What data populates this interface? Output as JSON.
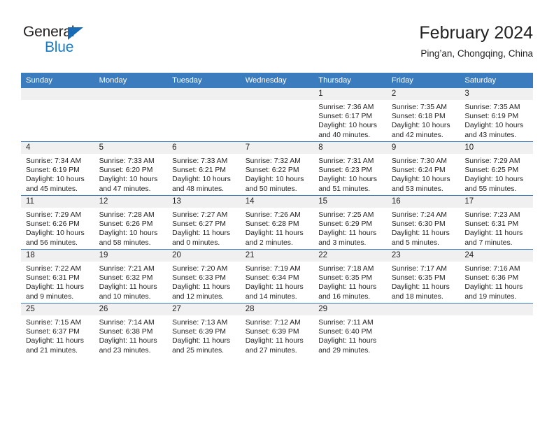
{
  "brand": {
    "name_part1": "General",
    "name_part2": "Blue",
    "accent_color": "#1a7bc6",
    "header_color": "#3a7cbe"
  },
  "header": {
    "title": "February 2024",
    "subtitle": "Ping’an, Chongqing, China"
  },
  "weekdays": [
    "Sunday",
    "Monday",
    "Tuesday",
    "Wednesday",
    "Thursday",
    "Friday",
    "Saturday"
  ],
  "labels": {
    "sunrise_prefix": "Sunrise:",
    "sunset_prefix": "Sunset:",
    "daylight_prefix": "Daylight:"
  },
  "weeks": [
    [
      {
        "day": "",
        "blank": true
      },
      {
        "day": "",
        "blank": true
      },
      {
        "day": "",
        "blank": true
      },
      {
        "day": "",
        "blank": true
      },
      {
        "day": "1",
        "sunrise": "Sunrise: 7:36 AM",
        "sunset": "Sunset: 6:17 PM",
        "daylight_l1": "Daylight: 10 hours",
        "daylight_l2": "and 40 minutes."
      },
      {
        "day": "2",
        "sunrise": "Sunrise: 7:35 AM",
        "sunset": "Sunset: 6:18 PM",
        "daylight_l1": "Daylight: 10 hours",
        "daylight_l2": "and 42 minutes."
      },
      {
        "day": "3",
        "sunrise": "Sunrise: 7:35 AM",
        "sunset": "Sunset: 6:19 PM",
        "daylight_l1": "Daylight: 10 hours",
        "daylight_l2": "and 43 minutes."
      }
    ],
    [
      {
        "day": "4",
        "sunrise": "Sunrise: 7:34 AM",
        "sunset": "Sunset: 6:19 PM",
        "daylight_l1": "Daylight: 10 hours",
        "daylight_l2": "and 45 minutes."
      },
      {
        "day": "5",
        "sunrise": "Sunrise: 7:33 AM",
        "sunset": "Sunset: 6:20 PM",
        "daylight_l1": "Daylight: 10 hours",
        "daylight_l2": "and 47 minutes."
      },
      {
        "day": "6",
        "sunrise": "Sunrise: 7:33 AM",
        "sunset": "Sunset: 6:21 PM",
        "daylight_l1": "Daylight: 10 hours",
        "daylight_l2": "and 48 minutes."
      },
      {
        "day": "7",
        "sunrise": "Sunrise: 7:32 AM",
        "sunset": "Sunset: 6:22 PM",
        "daylight_l1": "Daylight: 10 hours",
        "daylight_l2": "and 50 minutes."
      },
      {
        "day": "8",
        "sunrise": "Sunrise: 7:31 AM",
        "sunset": "Sunset: 6:23 PM",
        "daylight_l1": "Daylight: 10 hours",
        "daylight_l2": "and 51 minutes."
      },
      {
        "day": "9",
        "sunrise": "Sunrise: 7:30 AM",
        "sunset": "Sunset: 6:24 PM",
        "daylight_l1": "Daylight: 10 hours",
        "daylight_l2": "and 53 minutes."
      },
      {
        "day": "10",
        "sunrise": "Sunrise: 7:29 AM",
        "sunset": "Sunset: 6:25 PM",
        "daylight_l1": "Daylight: 10 hours",
        "daylight_l2": "and 55 minutes."
      }
    ],
    [
      {
        "day": "11",
        "sunrise": "Sunrise: 7:29 AM",
        "sunset": "Sunset: 6:26 PM",
        "daylight_l1": "Daylight: 10 hours",
        "daylight_l2": "and 56 minutes."
      },
      {
        "day": "12",
        "sunrise": "Sunrise: 7:28 AM",
        "sunset": "Sunset: 6:26 PM",
        "daylight_l1": "Daylight: 10 hours",
        "daylight_l2": "and 58 minutes."
      },
      {
        "day": "13",
        "sunrise": "Sunrise: 7:27 AM",
        "sunset": "Sunset: 6:27 PM",
        "daylight_l1": "Daylight: 11 hours",
        "daylight_l2": "and 0 minutes."
      },
      {
        "day": "14",
        "sunrise": "Sunrise: 7:26 AM",
        "sunset": "Sunset: 6:28 PM",
        "daylight_l1": "Daylight: 11 hours",
        "daylight_l2": "and 2 minutes."
      },
      {
        "day": "15",
        "sunrise": "Sunrise: 7:25 AM",
        "sunset": "Sunset: 6:29 PM",
        "daylight_l1": "Daylight: 11 hours",
        "daylight_l2": "and 3 minutes."
      },
      {
        "day": "16",
        "sunrise": "Sunrise: 7:24 AM",
        "sunset": "Sunset: 6:30 PM",
        "daylight_l1": "Daylight: 11 hours",
        "daylight_l2": "and 5 minutes."
      },
      {
        "day": "17",
        "sunrise": "Sunrise: 7:23 AM",
        "sunset": "Sunset: 6:31 PM",
        "daylight_l1": "Daylight: 11 hours",
        "daylight_l2": "and 7 minutes."
      }
    ],
    [
      {
        "day": "18",
        "sunrise": "Sunrise: 7:22 AM",
        "sunset": "Sunset: 6:31 PM",
        "daylight_l1": "Daylight: 11 hours",
        "daylight_l2": "and 9 minutes."
      },
      {
        "day": "19",
        "sunrise": "Sunrise: 7:21 AM",
        "sunset": "Sunset: 6:32 PM",
        "daylight_l1": "Daylight: 11 hours",
        "daylight_l2": "and 10 minutes."
      },
      {
        "day": "20",
        "sunrise": "Sunrise: 7:20 AM",
        "sunset": "Sunset: 6:33 PM",
        "daylight_l1": "Daylight: 11 hours",
        "daylight_l2": "and 12 minutes."
      },
      {
        "day": "21",
        "sunrise": "Sunrise: 7:19 AM",
        "sunset": "Sunset: 6:34 PM",
        "daylight_l1": "Daylight: 11 hours",
        "daylight_l2": "and 14 minutes."
      },
      {
        "day": "22",
        "sunrise": "Sunrise: 7:18 AM",
        "sunset": "Sunset: 6:35 PM",
        "daylight_l1": "Daylight: 11 hours",
        "daylight_l2": "and 16 minutes."
      },
      {
        "day": "23",
        "sunrise": "Sunrise: 7:17 AM",
        "sunset": "Sunset: 6:35 PM",
        "daylight_l1": "Daylight: 11 hours",
        "daylight_l2": "and 18 minutes."
      },
      {
        "day": "24",
        "sunrise": "Sunrise: 7:16 AM",
        "sunset": "Sunset: 6:36 PM",
        "daylight_l1": "Daylight: 11 hours",
        "daylight_l2": "and 19 minutes."
      }
    ],
    [
      {
        "day": "25",
        "sunrise": "Sunrise: 7:15 AM",
        "sunset": "Sunset: 6:37 PM",
        "daylight_l1": "Daylight: 11 hours",
        "daylight_l2": "and 21 minutes."
      },
      {
        "day": "26",
        "sunrise": "Sunrise: 7:14 AM",
        "sunset": "Sunset: 6:38 PM",
        "daylight_l1": "Daylight: 11 hours",
        "daylight_l2": "and 23 minutes."
      },
      {
        "day": "27",
        "sunrise": "Sunrise: 7:13 AM",
        "sunset": "Sunset: 6:39 PM",
        "daylight_l1": "Daylight: 11 hours",
        "daylight_l2": "and 25 minutes."
      },
      {
        "day": "28",
        "sunrise": "Sunrise: 7:12 AM",
        "sunset": "Sunset: 6:39 PM",
        "daylight_l1": "Daylight: 11 hours",
        "daylight_l2": "and 27 minutes."
      },
      {
        "day": "29",
        "sunrise": "Sunrise: 7:11 AM",
        "sunset": "Sunset: 6:40 PM",
        "daylight_l1": "Daylight: 11 hours",
        "daylight_l2": "and 29 minutes."
      },
      {
        "day": "",
        "blank": true
      },
      {
        "day": "",
        "blank": true
      }
    ]
  ]
}
